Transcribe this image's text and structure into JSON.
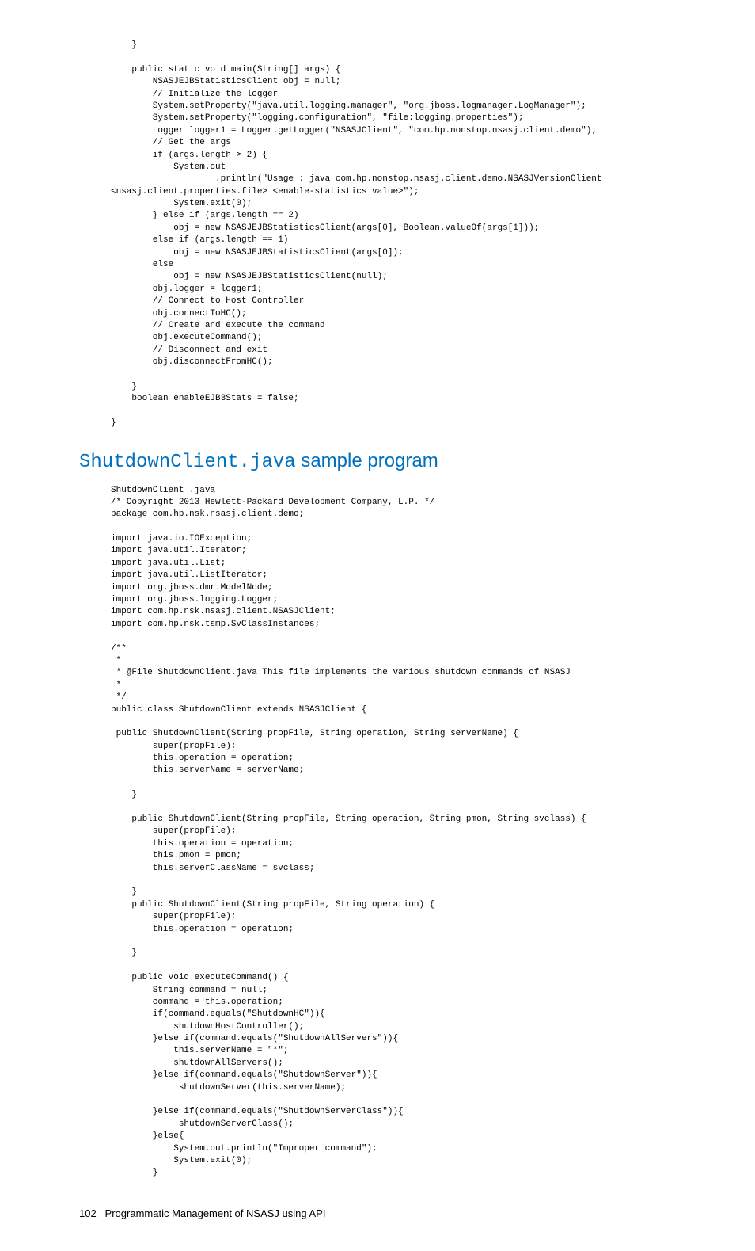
{
  "code_block_1": "    }\n\n    public static void main(String[] args) {\n        NSASJEJBStatisticsClient obj = null;\n        // Initialize the logger\n        System.setProperty(\"java.util.logging.manager\", \"org.jboss.logmanager.LogManager\");\n        System.setProperty(\"logging.configuration\", \"file:logging.properties\");\n        Logger logger1 = Logger.getLogger(\"NSASJClient\", \"com.hp.nonstop.nsasj.client.demo\");\n        // Get the args\n        if (args.length > 2) {\n            System.out\n                    .println(\"Usage : java com.hp.nonstop.nsasj.client.demo.NSASJVersionClient\n<nsasj.client.properties.file> <enable-statistics value>\");\n            System.exit(0);\n        } else if (args.length == 2)\n            obj = new NSASJEJBStatisticsClient(args[0], Boolean.valueOf(args[1]));\n        else if (args.length == 1)\n            obj = new NSASJEJBStatisticsClient(args[0]);\n        else\n            obj = new NSASJEJBStatisticsClient(null);\n        obj.logger = logger1;\n        // Connect to Host Controller\n        obj.connectToHC();\n        // Create and execute the command\n        obj.executeCommand();\n        // Disconnect and exit\n        obj.disconnectFromHC();\n\n    }\n    boolean enableEJB3Stats = false;\n\n}",
  "heading_mono": "ShutdownClient.java",
  "heading_rest": " sample program",
  "code_block_2": "ShutdownClient .java\n/* Copyright 2013 Hewlett-Packard Development Company, L.P. */\npackage com.hp.nsk.nsasj.client.demo;\n\nimport java.io.IOException;\nimport java.util.Iterator;\nimport java.util.List;\nimport java.util.ListIterator;\nimport org.jboss.dmr.ModelNode;\nimport org.jboss.logging.Logger;\nimport com.hp.nsk.nsasj.client.NSASJClient;\nimport com.hp.nsk.tsmp.SvClassInstances;\n\n/**\n * \n * @File ShutdownClient.java This file implements the various shutdown commands of NSASJ\n * \n */\npublic class ShutdownClient extends NSASJClient {\n\n public ShutdownClient(String propFile, String operation, String serverName) {\n        super(propFile);\n        this.operation = operation;\n        this.serverName = serverName;\n\n    }\n\n    public ShutdownClient(String propFile, String operation, String pmon, String svclass) {\n        super(propFile);\n        this.operation = operation;\n        this.pmon = pmon;\n        this.serverClassName = svclass;\n\n    }\n    public ShutdownClient(String propFile, String operation) {\n        super(propFile);\n        this.operation = operation;\n\n    }\n\n    public void executeCommand() {\n        String command = null;\n        command = this.operation;\n        if(command.equals(\"ShutdownHC\")){\n            shutdownHostController();\n        }else if(command.equals(\"ShutdownAllServers\")){\n            this.serverName = \"*\";\n            shutdownAllServers();\n        }else if(command.equals(\"ShutdownServer\")){\n             shutdownServer(this.serverName);\n\n        }else if(command.equals(\"ShutdownServerClass\")){\n             shutdownServerClass();\n        }else{\n            System.out.println(\"Improper command\");\n            System.exit(0);\n        }",
  "footer_page": "102",
  "footer_text": "Programmatic Management of NSASJ using API"
}
